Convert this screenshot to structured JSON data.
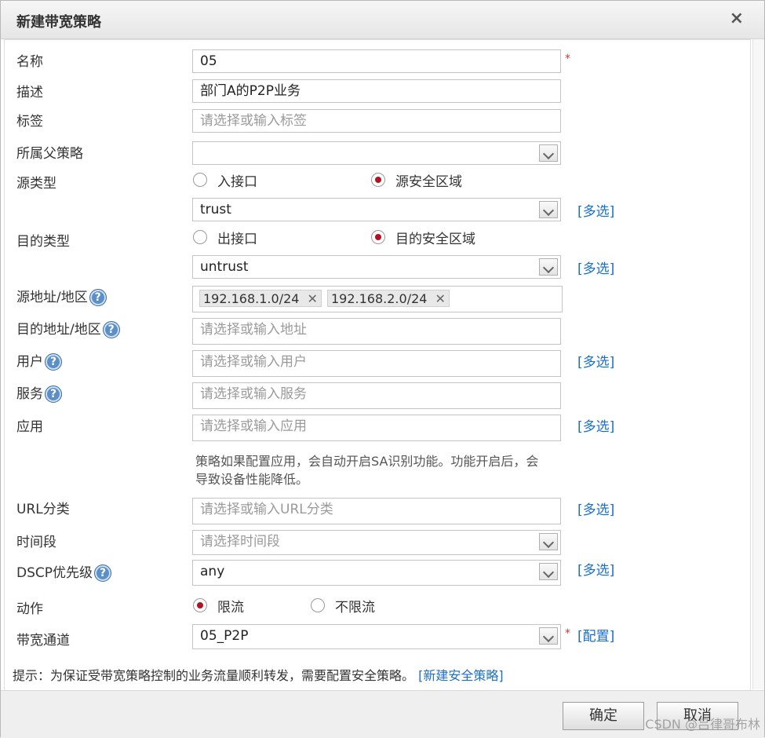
{
  "dialog": {
    "title": "新建带宽策略",
    "close_glyph": "×"
  },
  "form": {
    "name": {
      "label": "名称",
      "value": "05",
      "required": "*"
    },
    "desc": {
      "label": "描述",
      "value": "部门A的P2P业务"
    },
    "tags": {
      "label": "标签",
      "placeholder": "请选择或输入标签"
    },
    "parent": {
      "label": "所属父策略",
      "value": ""
    },
    "src_type": {
      "label": "源类型",
      "options": [
        "入接口",
        "源安全区域"
      ],
      "selected": "源安全区域"
    },
    "src_zone": {
      "value": "trust",
      "multi": "[多选]"
    },
    "dst_type": {
      "label": "目的类型",
      "options": [
        "出接口",
        "目的安全区域"
      ],
      "selected": "目的安全区域"
    },
    "dst_zone": {
      "value": "untrust",
      "multi": "[多选]"
    },
    "src_addr": {
      "label": "源地址/地区",
      "tags": [
        "192.168.1.0/24",
        "192.168.2.0/24"
      ]
    },
    "dst_addr": {
      "label": "目的地址/地区",
      "placeholder": "请选择或输入地址"
    },
    "user": {
      "label": "用户",
      "placeholder": "请选择或输入用户",
      "multi": "[多选]"
    },
    "service": {
      "label": "服务",
      "placeholder": "请选择或输入服务"
    },
    "app": {
      "label": "应用",
      "placeholder": "请选择或输入应用",
      "multi": "[多选]",
      "note": "策略如果配置应用，会自动开启SA识别功能。功能开启后，会导致设备性能降低。"
    },
    "url": {
      "label": "URL分类",
      "placeholder": "请选择或输入URL分类",
      "multi": "[多选]"
    },
    "time": {
      "label": "时间段",
      "placeholder": "请选择时间段"
    },
    "dscp": {
      "label": "DSCP优先级",
      "value": "any",
      "multi": "[多选]"
    },
    "action": {
      "label": "动作",
      "options": [
        "限流",
        "不限流"
      ],
      "selected": "限流"
    },
    "channel": {
      "label": "带宽通道",
      "value": "05_P2P",
      "required": "*",
      "config": "[配置]"
    },
    "help_glyph": "?"
  },
  "tip": {
    "text": "提示：为保证受带宽策略控制的业务流量顺利转发，需要配置安全策略。",
    "link": "[新建安全策略]"
  },
  "buttons": {
    "ok": "确定",
    "cancel": "取消"
  },
  "watermark": "CSDN @吕律哥布林",
  "colors": {
    "link": "#1a6fc7",
    "required": "#dd3333",
    "radio_dot": "#b3121f"
  }
}
